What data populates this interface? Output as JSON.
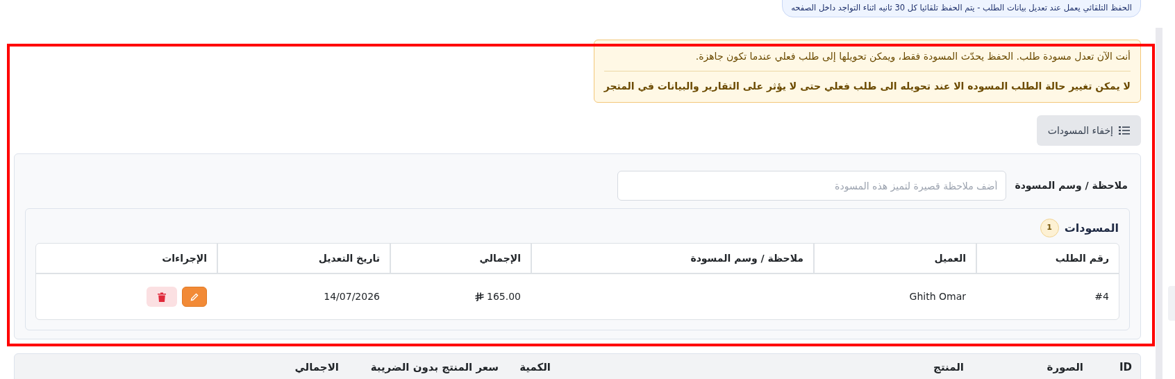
{
  "autosave_notice": "الحفظ التلقائي يعمل عند تعديل بيانات الطلب - يتم الحفظ تلقائيا كل 30 ثانيه اثناء التواجد داخل الصفحه",
  "alert": {
    "message": "أنت الآن تعدل مسودة طلب. الحفظ يحدّث المسودة فقط، ويمكن تحويلها إلى طلب فعلي عندما تكون جاهزة.",
    "warning": "لا يمكن تغيير حالة الطلب المسوده الا عند تحويله الى طلب فعلي حتى لا يؤثر على التقارير والبيانات في المتجر"
  },
  "toggle_button": {
    "label": "إخفاء المسودات"
  },
  "note_field": {
    "label": "ملاحظة / وسم المسودة",
    "placeholder": "أضف ملاحظة قصيرة لتميز هذه المسودة"
  },
  "drafts": {
    "title": "المسودات",
    "count": "1",
    "columns": [
      "رقم الطلب",
      "العميل",
      "ملاحظة / وسم المسودة",
      "الإجمالي",
      "تاريخ التعديل",
      "الإجراءات"
    ],
    "rows": [
      {
        "order_number": "#4",
        "customer": "Ghith Omar",
        "note": "",
        "total": "165.00",
        "modified": "14/07/2026"
      }
    ]
  },
  "items_table": {
    "columns": [
      "ID",
      "الصورة",
      "المنتج",
      "الكمية",
      "سعر المنتج بدون الضريبة",
      "الاجمالي"
    ]
  }
}
